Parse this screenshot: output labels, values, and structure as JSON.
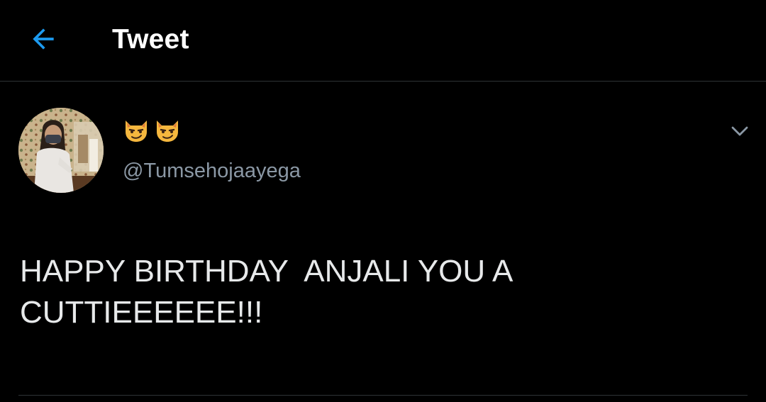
{
  "header": {
    "title": "Tweet",
    "back_icon": "arrow-left-icon"
  },
  "tweet": {
    "author_display_name_icons": [
      "smirking-cat-face-icon",
      "smirking-cat-face-icon"
    ],
    "author_handle": "@Tumsehojaayega",
    "text": "HAPPY BIRTHDAY  ANJALI YOU A CUTTIEEEEEE!!!",
    "more_icon": "chevron-down-icon"
  },
  "colors": {
    "background": "#000000",
    "accent": "#1d9bf0",
    "text_primary": "#e7e9ea",
    "text_secondary": "#8b98a5",
    "divider": "#2f3336"
  }
}
